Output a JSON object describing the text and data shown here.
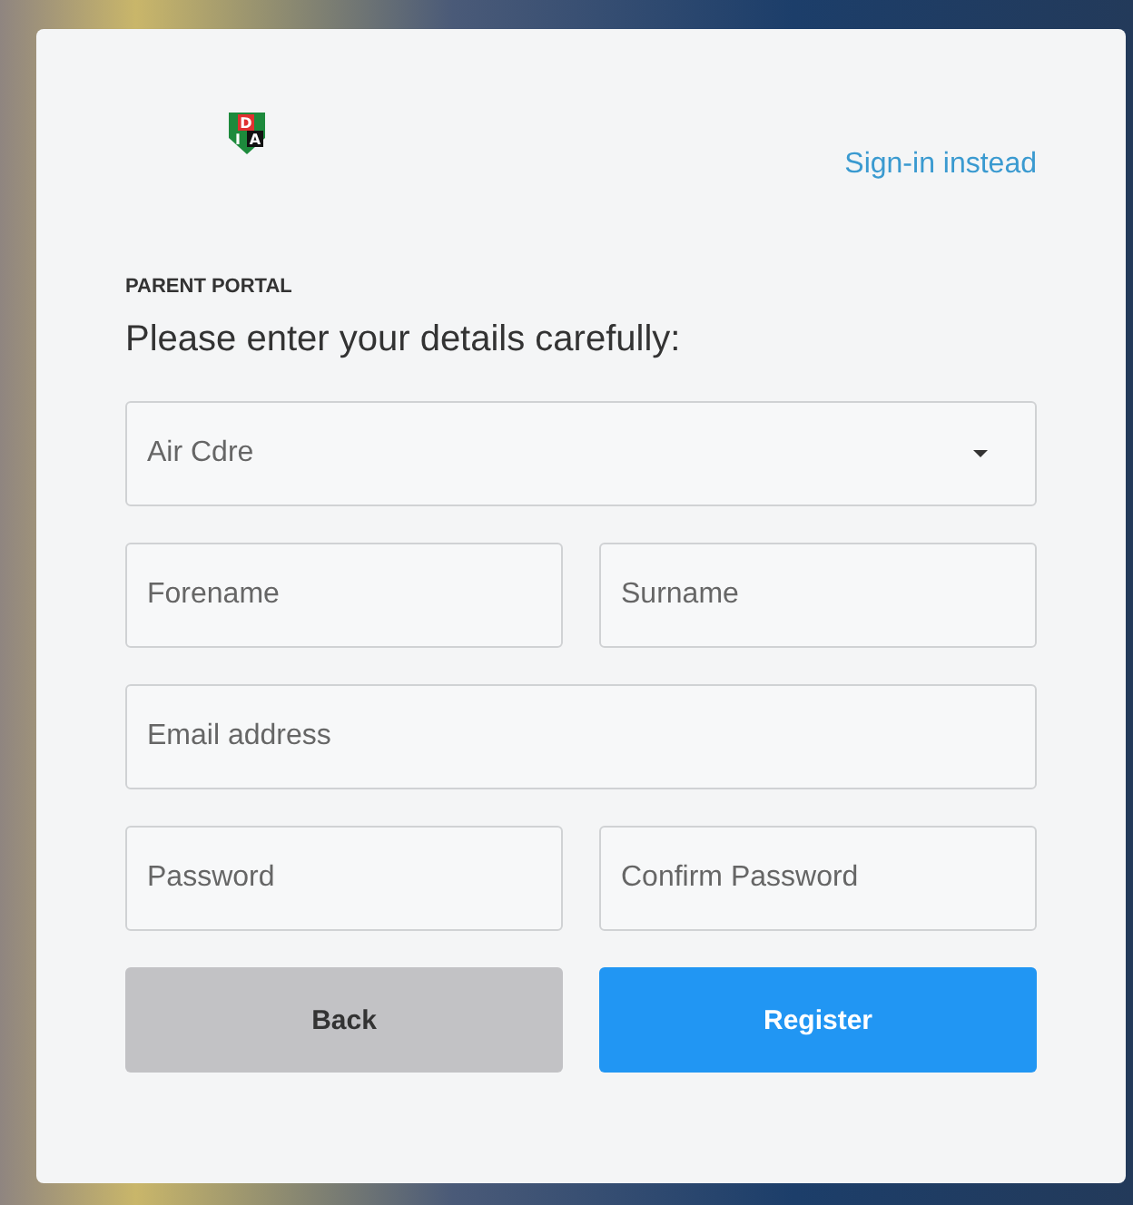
{
  "logo": {
    "letters": [
      "D",
      "I",
      "A"
    ]
  },
  "sign_in_link": "Sign-in instead",
  "eyebrow": "PARENT PORTAL",
  "heading": "Please enter your details carefully:",
  "rows": [
    {
      "fields": [
        {
          "kind": "select",
          "value": "Air Cdre"
        }
      ]
    },
    {
      "fields": [
        {
          "kind": "text",
          "placeholder": "Forename"
        },
        {
          "kind": "text",
          "placeholder": "Surname"
        }
      ]
    },
    {
      "fields": [
        {
          "kind": "text",
          "placeholder": "Email address"
        }
      ]
    },
    {
      "fields": [
        {
          "kind": "password",
          "placeholder": "Password"
        },
        {
          "kind": "password",
          "placeholder": "Confirm Password"
        }
      ]
    }
  ],
  "buttons": [
    {
      "kind": "secondary",
      "label": "Back"
    },
    {
      "kind": "primary",
      "label": "Register"
    }
  ]
}
